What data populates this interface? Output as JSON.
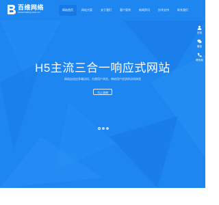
{
  "brand": {
    "name": "百维网络",
    "domain": "www.baiwj.com.cn"
  },
  "nav": {
    "items": [
      {
        "label": "网站首页",
        "active": true
      },
      {
        "label": "网站方案",
        "active": false
      },
      {
        "label": "关于我们",
        "active": false
      },
      {
        "label": "客户案例",
        "active": false
      },
      {
        "label": "新闻资讯",
        "active": false
      },
      {
        "label": "技术支持",
        "active": false
      },
      {
        "label": "联系我们",
        "active": false
      }
    ]
  },
  "side_tools": {
    "items": [
      {
        "label": "在线",
        "icon": "user-icon"
      },
      {
        "label": "微信",
        "icon": "wechat-icon"
      },
      {
        "label": "联系我",
        "icon": "phone-icon"
      }
    ]
  },
  "hero": {
    "title": "H5主流三合一响应式网站",
    "subtitle": "网站自适应多端访问，方便用户浏览，带给用户优质的访问体验",
    "cta": "马上咨询",
    "slides": [
      {
        "active": true
      },
      {
        "active": false
      },
      {
        "active": false
      }
    ]
  },
  "colors": {
    "hero_bg": "#1e86f0",
    "nav_active_bg": "#167ae6",
    "text": "#ffffff"
  }
}
